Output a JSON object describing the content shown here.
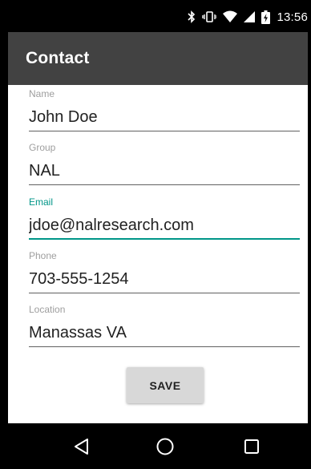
{
  "status_bar": {
    "time": "13:56",
    "icons": [
      "bluetooth-icon",
      "vibrate-icon",
      "wifi-icon",
      "signal-icon",
      "battery-charging-icon"
    ]
  },
  "app_bar": {
    "title": "Contact"
  },
  "form": {
    "fields": [
      {
        "label": "Name",
        "value": "John Doe",
        "focused": false
      },
      {
        "label": "Group",
        "value": "NAL",
        "focused": false
      },
      {
        "label": "Email",
        "value": "jdoe@nalresearch.com",
        "focused": true
      },
      {
        "label": "Phone",
        "value": "703-555-1254",
        "focused": false
      },
      {
        "label": "Location",
        "value": "Manassas VA",
        "focused": false
      }
    ],
    "save_label": "SAVE"
  },
  "nav_bar": {
    "icons": [
      "back-icon",
      "home-icon",
      "recents-icon"
    ]
  },
  "colors": {
    "accent": "#009688",
    "app_bar": "#424242",
    "hint": "#9e9e9e"
  }
}
